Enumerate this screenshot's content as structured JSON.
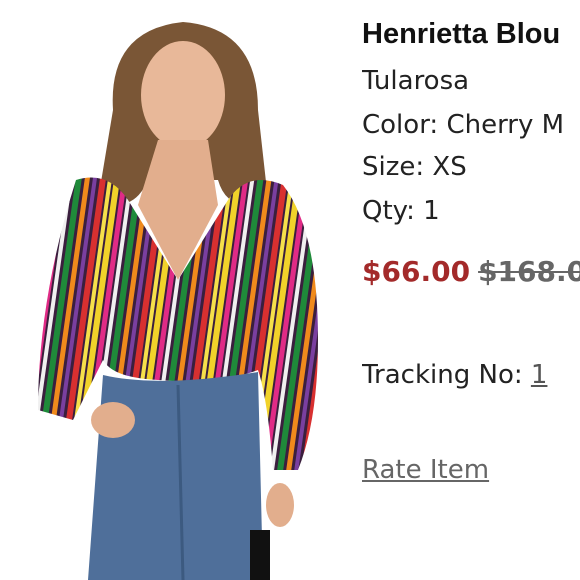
{
  "product": {
    "title": "Henrietta Blou",
    "brand": "Tularosa",
    "color": "Color: Cherry M",
    "size": "Size: XS",
    "qty": "Qty: 1",
    "price_sale": "$66.00",
    "price_original": "$168.0"
  },
  "tracking": {
    "label": "Tracking No: ",
    "value": "1"
  },
  "actions": {
    "rate_item": "Rate Item"
  },
  "colors": {
    "sale_price": "#a32a2a",
    "text": "#222222",
    "muted": "#666666"
  }
}
